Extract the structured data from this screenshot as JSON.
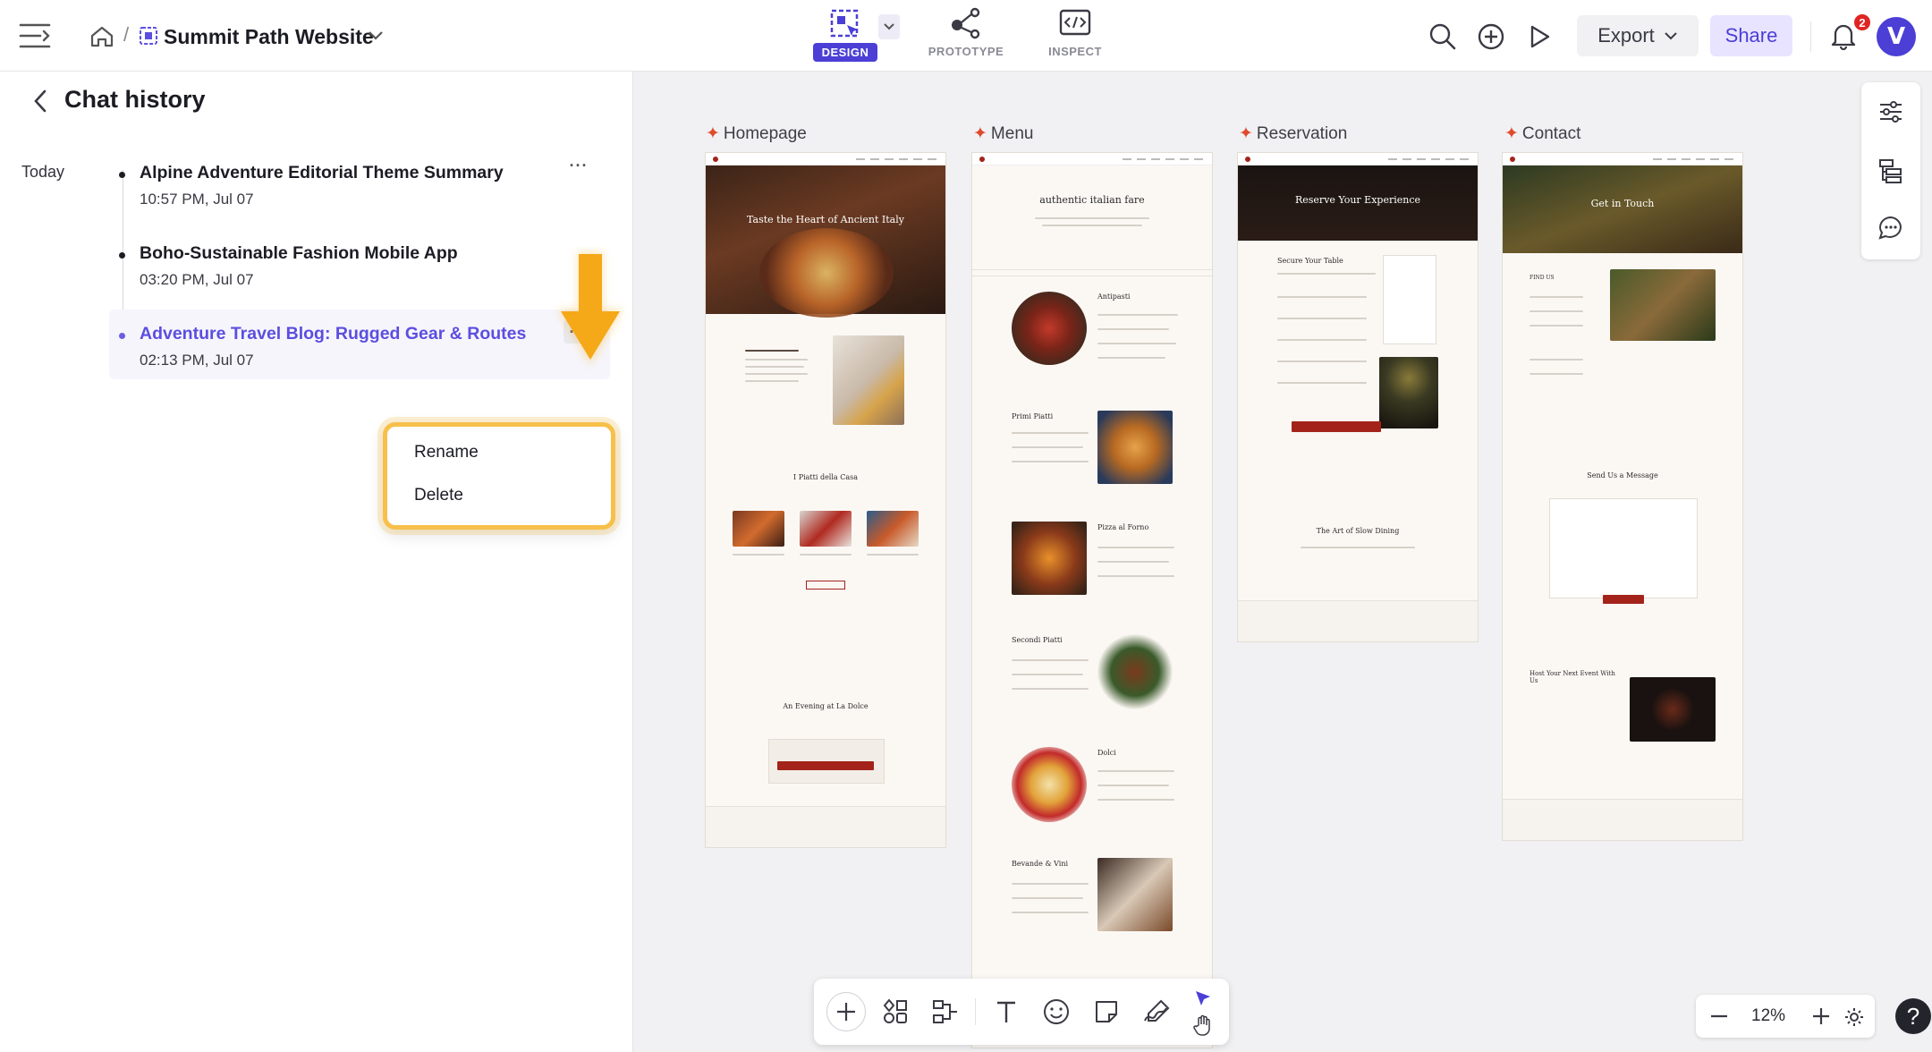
{
  "header": {
    "project_title": "Summit Path Website",
    "breadcrumb_separator": "/",
    "modes": [
      {
        "label": "DESIGN",
        "active": true
      },
      {
        "label": "PROTOTYPE",
        "active": false
      },
      {
        "label": "INSPECT",
        "active": false
      }
    ],
    "export_label": "Export",
    "share_label": "Share",
    "notification_count": "2",
    "avatar_letter": "V",
    "accent_color": "#4b3fd6"
  },
  "chat_history": {
    "title": "Chat history",
    "group_label": "Today",
    "items": [
      {
        "title": "Alpine Adventure Editorial Theme Summary",
        "time": "10:57 PM, Jul 07",
        "active": false
      },
      {
        "title": "Boho-Sustainable Fashion Mobile App",
        "time": "03:20 PM, Jul 07",
        "active": false
      },
      {
        "title": "Adventure Travel Blog: Rugged Gear & Routes",
        "time": "02:13 PM, Jul 07",
        "active": true
      }
    ],
    "context_menu": [
      "Rename",
      "Delete"
    ],
    "more_glyph": "···"
  },
  "canvas": {
    "frames": [
      {
        "label": "Homepage",
        "hero_text": "Taste the Heart of Ancient Italy",
        "section_title": "I Piatti della Casa",
        "event_title": "An Evening at La Dolce"
      },
      {
        "label": "Menu",
        "hero_text": "authentic italian fare",
        "sections": [
          "Antipasti",
          "Primi Piatti",
          "Pizza al Forno",
          "Secondi Piatti",
          "Dolci",
          "Bevande & Vini"
        ]
      },
      {
        "label": "Reservation",
        "hero_text": "Reserve Your Experience",
        "section_title": "Secure Your Table",
        "slow_title": "The Art of Slow Dining"
      },
      {
        "label": "Contact",
        "hero_text": "Get in Touch",
        "find_label": "FIND US",
        "message_title": "Send Us a Message",
        "event_title": "Host Your Next Event With Us"
      }
    ]
  },
  "zoom": {
    "value": "12%"
  },
  "help_label": "?"
}
